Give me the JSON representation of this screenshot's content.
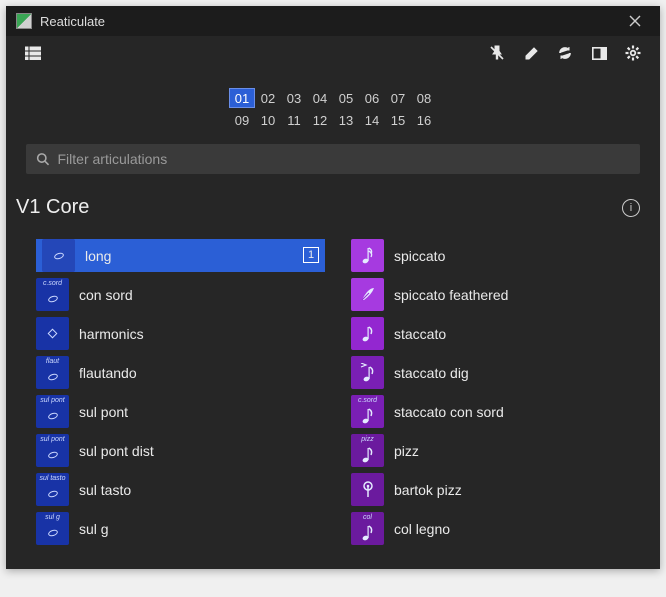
{
  "window": {
    "title": "Reaticulate"
  },
  "search": {
    "placeholder": "Filter articulations"
  },
  "channels": {
    "row1": [
      "01",
      "02",
      "03",
      "04",
      "05",
      "06",
      "07",
      "08"
    ],
    "row2": [
      "09",
      "10",
      "11",
      "12",
      "13",
      "14",
      "15",
      "16"
    ],
    "selected": "01"
  },
  "section": {
    "title": "V1 Core"
  },
  "badge": {
    "num": "1"
  },
  "left": [
    {
      "label": "long",
      "tile_color": "tile-blue",
      "super": "",
      "icon": "wholenote",
      "selected": true
    },
    {
      "label": "con sord",
      "tile_color": "tile-blue-dark",
      "super": "c.sord",
      "icon": "wholenote"
    },
    {
      "label": "harmonics",
      "tile_color": "tile-blue-dark",
      "super": "",
      "icon": "diamond"
    },
    {
      "label": "flautando",
      "tile_color": "tile-blue-dark",
      "super": "flaut",
      "icon": "wholenote"
    },
    {
      "label": "sul pont",
      "tile_color": "tile-blue-dark",
      "super": "sul pont",
      "icon": "wholenote"
    },
    {
      "label": "sul pont dist",
      "tile_color": "tile-blue-dark",
      "super": "sul pont",
      "icon": "wholenote"
    },
    {
      "label": "sul tasto",
      "tile_color": "tile-blue-dark",
      "super": "sul tasto",
      "icon": "wholenote"
    },
    {
      "label": "sul g",
      "tile_color": "tile-blue-dark",
      "super": "sul g",
      "icon": "wholenote"
    }
  ],
  "right": [
    {
      "label": "spiccato",
      "tile_color": "tile-purple-lt",
      "super": "",
      "icon": "sixteenth"
    },
    {
      "label": "spiccato feathered",
      "tile_color": "tile-purple-lt",
      "super": "",
      "icon": "feather"
    },
    {
      "label": "staccato",
      "tile_color": "tile-purple",
      "super": "",
      "icon": "eighth"
    },
    {
      "label": "staccato dig",
      "tile_color": "tile-purple-dk",
      "super": "",
      "icon": "eighth-accent"
    },
    {
      "label": "staccato con sord",
      "tile_color": "tile-purple-dk",
      "super": "c.sord",
      "icon": "eighth"
    },
    {
      "label": "pizz",
      "tile_color": "tile-purple-dk2",
      "super": "pizz",
      "icon": "eighth"
    },
    {
      "label": "bartok pizz",
      "tile_color": "tile-purple-dk2",
      "super": "",
      "icon": "bartok"
    },
    {
      "label": "col legno",
      "tile_color": "tile-purple-dk2",
      "super": "col",
      "icon": "eighth"
    }
  ]
}
